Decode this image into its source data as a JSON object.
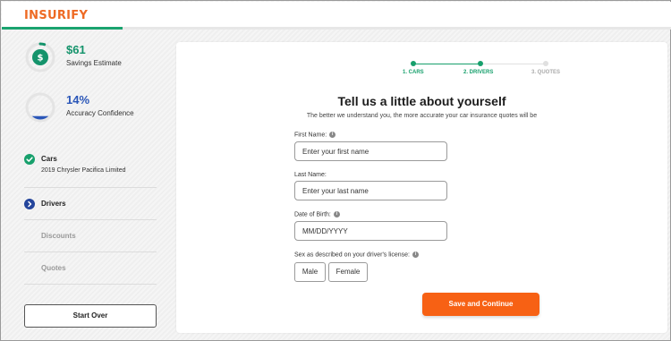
{
  "brand": {
    "logo_text": "INSURIFY",
    "color": "#ee6a24",
    "progress_fraction": 0.18,
    "progress_color": "#1aa36f"
  },
  "stats": {
    "savings": {
      "value": "$61",
      "label": "Savings Estimate",
      "icon": "dollar-icon",
      "color": "#14936b",
      "ring_fraction": 0.05
    },
    "accuracy": {
      "value": "14%",
      "label": "Accuracy Confidence",
      "color": "#2a56b8",
      "ring_fraction": 0.14
    }
  },
  "nav": {
    "items": [
      {
        "label": "Cars",
        "subtitle": "2019 Chrysler Pacifica Limited",
        "state": "done",
        "icon": "check-icon"
      },
      {
        "label": "Drivers",
        "subtitle": "",
        "state": "current",
        "icon": "chevron-right-icon"
      },
      {
        "label": "Discounts",
        "subtitle": "",
        "state": "pending",
        "icon": ""
      },
      {
        "label": "Quotes",
        "subtitle": "",
        "state": "pending",
        "icon": ""
      }
    ],
    "start_over_label": "Start Over"
  },
  "steps": [
    {
      "label": "1. CARS",
      "state": "done"
    },
    {
      "label": "2. DRIVERS",
      "state": "current"
    },
    {
      "label": "3. QUOTES",
      "state": "pending"
    }
  ],
  "form": {
    "title": "Tell us a little about yourself",
    "subtitle": "The better we understand you, the more accurate your car insurance quotes will be",
    "first_name": {
      "label": "First Name:",
      "placeholder": "Enter your first name",
      "value": ""
    },
    "last_name": {
      "label": "Last Name:",
      "placeholder": "Enter your last name",
      "value": ""
    },
    "dob": {
      "label": "Date of Birth:",
      "placeholder": "MM/DD/YYYY",
      "value": ""
    },
    "sex": {
      "label": "Sex as described on your driver's license:",
      "options": [
        "Male",
        "Female"
      ]
    },
    "submit_label": "Save and Continue",
    "submit_color": "#f76114"
  }
}
